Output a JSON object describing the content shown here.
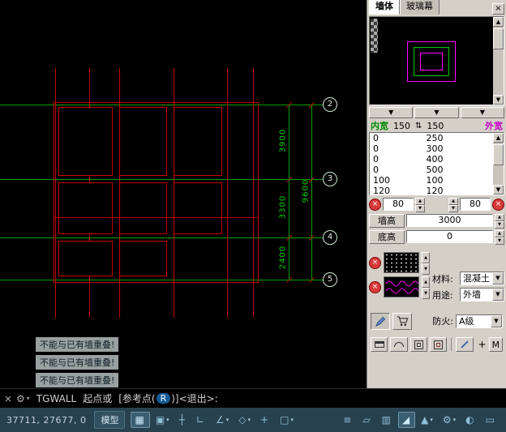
{
  "panel": {
    "tabs": [
      {
        "label": "墙体"
      },
      {
        "label": "玻璃幕"
      }
    ],
    "close_glyph": "×",
    "combo_glyph": "▼",
    "width_table": {
      "inner_label": "内宽",
      "inner_width": "150",
      "swap_glyph": "⇅",
      "outer_width": "150",
      "outer_label": "外宽",
      "rows": [
        {
          "inner": "0",
          "outer": "250"
        },
        {
          "inner": "0",
          "outer": "300"
        },
        {
          "inner": "0",
          "outer": "400"
        },
        {
          "inner": "0",
          "outer": "500"
        },
        {
          "inner": "100",
          "outer": "100"
        },
        {
          "inner": "120",
          "outer": "120"
        }
      ]
    },
    "left_spinner": "80",
    "right_spinner": "80",
    "wall_height": {
      "label": "墙高",
      "value": "3000"
    },
    "base_height": {
      "label": "底高",
      "value": "0"
    },
    "material": {
      "label": "材料:",
      "value": "混凝土"
    },
    "usage": {
      "label": "用途:",
      "value": "外墙"
    },
    "fire": {
      "label": "防火:",
      "value": "A级"
    },
    "plus_glyph": "+",
    "m_button_label": "M"
  },
  "drawing": {
    "dim_3900": "3900",
    "dim_3300": "3300",
    "dim_2400": "2400",
    "dim_9600": "9600",
    "bubbles": [
      "2",
      "3",
      "4",
      "5"
    ],
    "errors": [
      "不能与已有墙重叠!",
      "不能与已有墙重叠!",
      "不能与已有墙重叠!"
    ]
  },
  "command_line": {
    "close_glyph": "×",
    "customize_glyph": "⚙",
    "caret_glyph": "▾",
    "command": "TGWALL",
    "prompt": "起点或",
    "option_open": "[参考点(",
    "option_key": "R",
    "option_close": ")]",
    "suffix": "<退出>:"
  },
  "status_bar": {
    "coordinates": "37711, 27677, 0",
    "model_label": "模型",
    "left_icons": [
      {
        "glyph": "▦",
        "caret": ""
      },
      {
        "glyph": "▣",
        "caret": "▾"
      },
      {
        "glyph": "┼",
        "caret": ""
      },
      {
        "glyph": "∟",
        "caret": ""
      },
      {
        "glyph": "∠",
        "caret": "▾"
      },
      {
        "glyph": "◇",
        "caret": "▾"
      },
      {
        "glyph": "+",
        "caret": ""
      },
      {
        "glyph": "□",
        "caret": "▾"
      }
    ],
    "right_icons": [
      {
        "glyph": "≡",
        "caret": ""
      },
      {
        "glyph": "▱",
        "caret": ""
      },
      {
        "glyph": "▥",
        "caret": ""
      },
      {
        "glyph": "◢",
        "caret": ""
      },
      {
        "glyph": "▲",
        "caret": "▾"
      },
      {
        "glyph": "⚙",
        "caret": "▾"
      },
      {
        "glyph": "◐",
        "caret": ""
      },
      {
        "glyph": "▭",
        "caret": ""
      }
    ]
  },
  "colors": {
    "wall_red": "#c40000",
    "axis_green": "#00a000",
    "dim_text_green": "#00d200",
    "preview_magenta": "#ff00ff",
    "preview_green": "#00c800",
    "panel_gray": "#d4d0c8",
    "statusbar_bg": "#28414f",
    "option_pill_blue": "#135a96"
  }
}
